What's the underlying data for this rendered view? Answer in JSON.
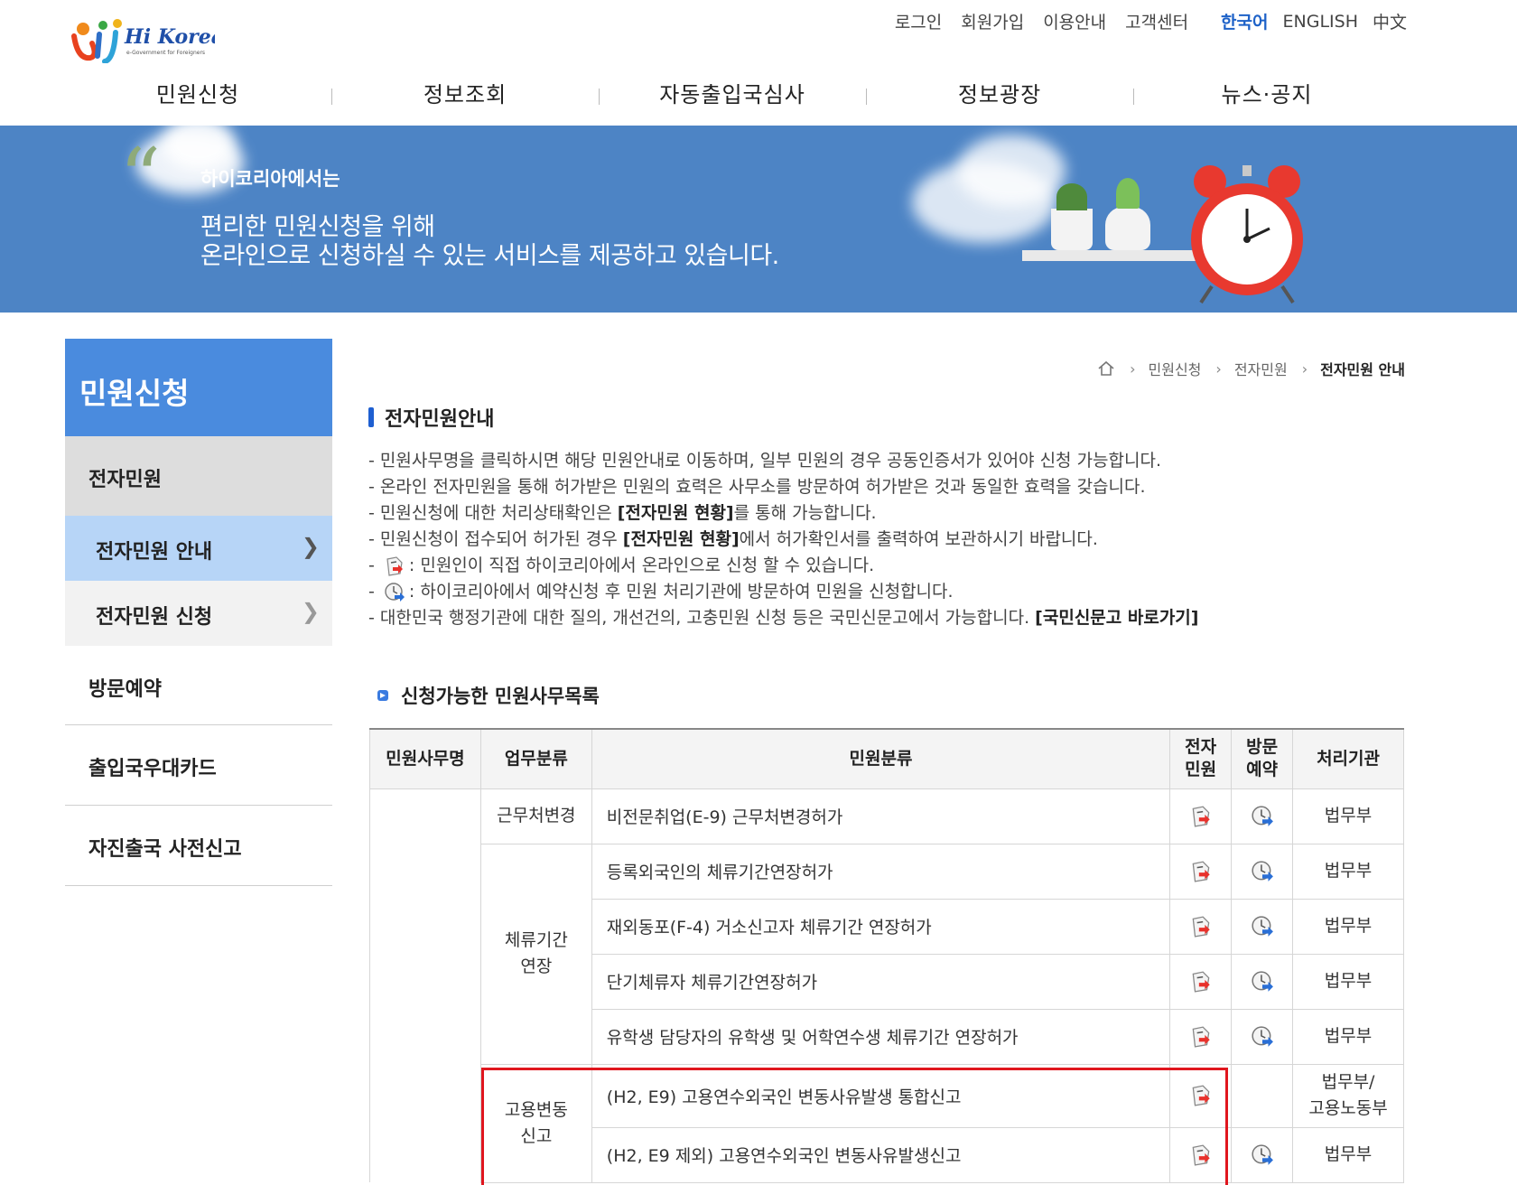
{
  "header": {
    "logo_text": "Hi Korea",
    "logo_tagline": "e-Government for Foreigners",
    "util_links": [
      "로그인",
      "회원가입",
      "이용안내",
      "고객센터"
    ],
    "languages": [
      "한국어",
      "ENGLISH",
      "中文"
    ],
    "active_language": "한국어",
    "nav": [
      "민원신청",
      "정보조회",
      "자동출입국심사",
      "정보광장",
      "뉴스·공지"
    ]
  },
  "banner": {
    "subtitle": "하이코리아에서는",
    "line1": "편리한 민원신청을 위해",
    "line2": "온라인으로 신청하실 수 있는 서비스를 제공하고 있습니다."
  },
  "sidebar": {
    "title": "민원신청",
    "group": "전자민원",
    "sub_items": [
      {
        "label": "전자민원 안내",
        "active": true
      },
      {
        "label": "전자민원 신청",
        "active": false
      }
    ],
    "items": [
      "방문예약",
      "출입국우대카드",
      "자진출국 사전신고"
    ]
  },
  "breadcrumb": [
    "민원신청",
    "전자민원",
    "전자민원 안내"
  ],
  "content": {
    "title": "전자민원안내",
    "notes": [
      {
        "pre": "- 민원사무명을 클릭하시면 해당 민원안내로 이동하며, 일부 민원의 경우 공동인증서가 있어야 신청 가능합니다."
      },
      {
        "pre": "- 온라인 전자민원을 통해 허가받은 민원의 효력은 사무소를 방문하여 허가받은 것과 동일한 효력을 갖습니다."
      },
      {
        "pre": "- 민원신청에 대한 처리상태확인은 ",
        "bold": "[전자민원 현황]",
        "post": "를 통해 가능합니다."
      },
      {
        "pre": "- 민원신청이 접수되어 허가된 경우 ",
        "bold": "[전자민원 현황]",
        "post": "에서 허가확인서를 출력하여 보관하시기 바랍니다."
      },
      {
        "pre": "- ",
        "icon": "e-petition-icon",
        "post": ": 민원인이 직접 하이코리아에서 온라인으로 신청 할 수 있습니다."
      },
      {
        "pre": "- ",
        "icon": "visit-reservation-icon",
        "post": ": 하이코리아에서 예약신청 후 민원 처리기관에 방문하여 민원을 신청합니다."
      },
      {
        "pre": "- 대한민국 행정기관에 대한 질의, 개선건의, 고충민원 신청 등은 국민신문고에서 가능합니다. ",
        "bold": "[국민신문고 바로가기]",
        "post": ""
      }
    ],
    "list_title": "신청가능한 민원사무목록"
  },
  "table": {
    "headers": [
      "민원사무명",
      "업무분류",
      "민원분류",
      "전자\n민원",
      "방문\n예약",
      "처리기관"
    ],
    "rows": [
      {
        "category": "근무처변경",
        "span": 1,
        "name": "비전문취업(E-9) 근무처변경허가",
        "e": true,
        "v": true,
        "org": "법무부"
      },
      {
        "category": "체류기간\n연장",
        "span": 4,
        "name": "등록외국인의 체류기간연장허가",
        "e": true,
        "v": true,
        "org": "법무부"
      },
      {
        "name": "재외동포(F-4) 거소신고자 체류기간 연장허가",
        "e": true,
        "v": true,
        "org": "법무부"
      },
      {
        "name": "단기체류자 체류기간연장허가",
        "e": true,
        "v": true,
        "org": "법무부"
      },
      {
        "name": "유학생 담당자의 유학생 및 어학연수생 체류기간 연장허가",
        "e": true,
        "v": true,
        "org": "법무부"
      },
      {
        "category": "고용변동\n신고",
        "span": 2,
        "name": "(H2, E9) 고용연수외국인 변동사유발생 통합신고",
        "e": true,
        "v": false,
        "org": "법무부/\n고용노동부"
      },
      {
        "name": "(H2, E9 제외) 고용연수외국인 변동사유발생신고",
        "e": true,
        "v": true,
        "org": "법무부"
      }
    ]
  },
  "colors": {
    "banner_bg": "#4d84c5",
    "sidebar_title_bg": "#4a8bde",
    "sidebar_active_bg": "#b7d5f7",
    "highlight_box": "#e0161e",
    "active_language": "#1e62c8"
  }
}
